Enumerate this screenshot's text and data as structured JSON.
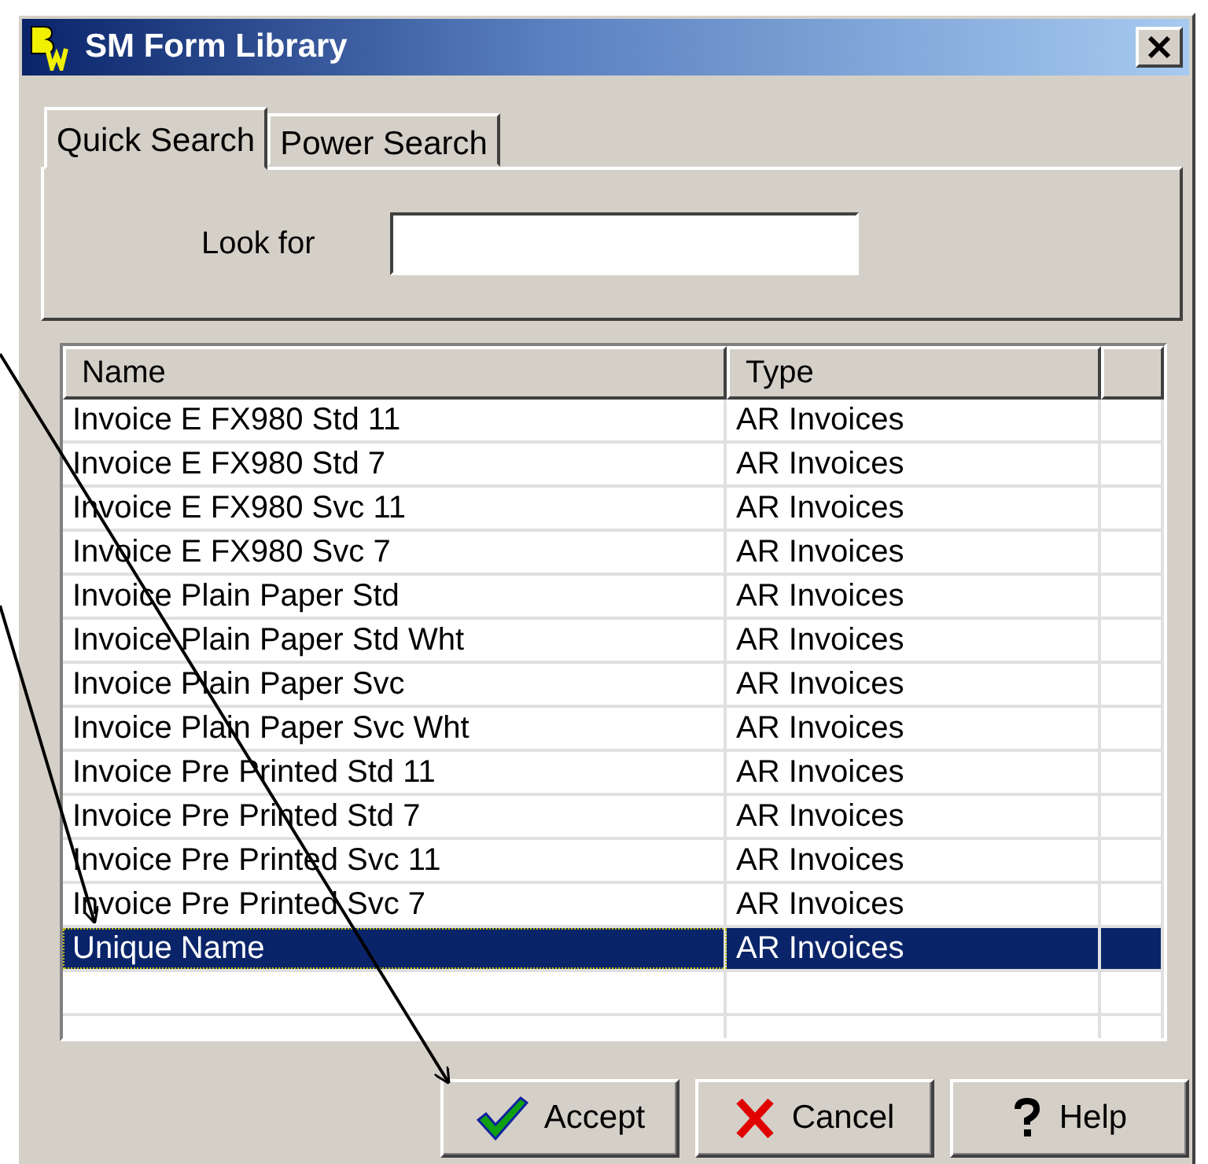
{
  "window": {
    "title": "SM Form Library"
  },
  "tabs": [
    {
      "label": "Quick Search",
      "selected": true
    },
    {
      "label": "Power Search",
      "selected": false
    }
  ],
  "search": {
    "label": "Look for"
  },
  "list": {
    "columns": [
      "Name",
      "Type"
    ],
    "rows": [
      {
        "name": "Invoice E FX980 Std 11",
        "type": "AR Invoices",
        "selected": false
      },
      {
        "name": "Invoice E FX980 Std 7",
        "type": "AR Invoices",
        "selected": false
      },
      {
        "name": "Invoice E FX980 Svc 11",
        "type": "AR Invoices",
        "selected": false
      },
      {
        "name": "Invoice E FX980 Svc 7",
        "type": "AR Invoices",
        "selected": false
      },
      {
        "name": "Invoice Plain Paper Std",
        "type": "AR Invoices",
        "selected": false
      },
      {
        "name": "Invoice Plain Paper Std Wht",
        "type": "AR Invoices",
        "selected": false
      },
      {
        "name": "Invoice Plain Paper Svc",
        "type": "AR Invoices",
        "selected": false
      },
      {
        "name": "Invoice Plain Paper Svc Wht",
        "type": "AR Invoices",
        "selected": false
      },
      {
        "name": "Invoice Pre Printed Std 11",
        "type": "AR Invoices",
        "selected": false
      },
      {
        "name": "Invoice Pre Printed Std 7",
        "type": "AR Invoices",
        "selected": false
      },
      {
        "name": "Invoice Pre Printed Svc 11",
        "type": "AR Invoices",
        "selected": false
      },
      {
        "name": "Invoice Pre Printed Svc 7",
        "type": "AR Invoices",
        "selected": false
      },
      {
        "name": "Unique Name",
        "type": "AR Invoices",
        "selected": true
      }
    ]
  },
  "buttons": [
    {
      "kind": "accept",
      "label": "Accept"
    },
    {
      "kind": "cancel",
      "label": "Cancel"
    },
    {
      "kind": "help",
      "label": "Help"
    }
  ]
}
